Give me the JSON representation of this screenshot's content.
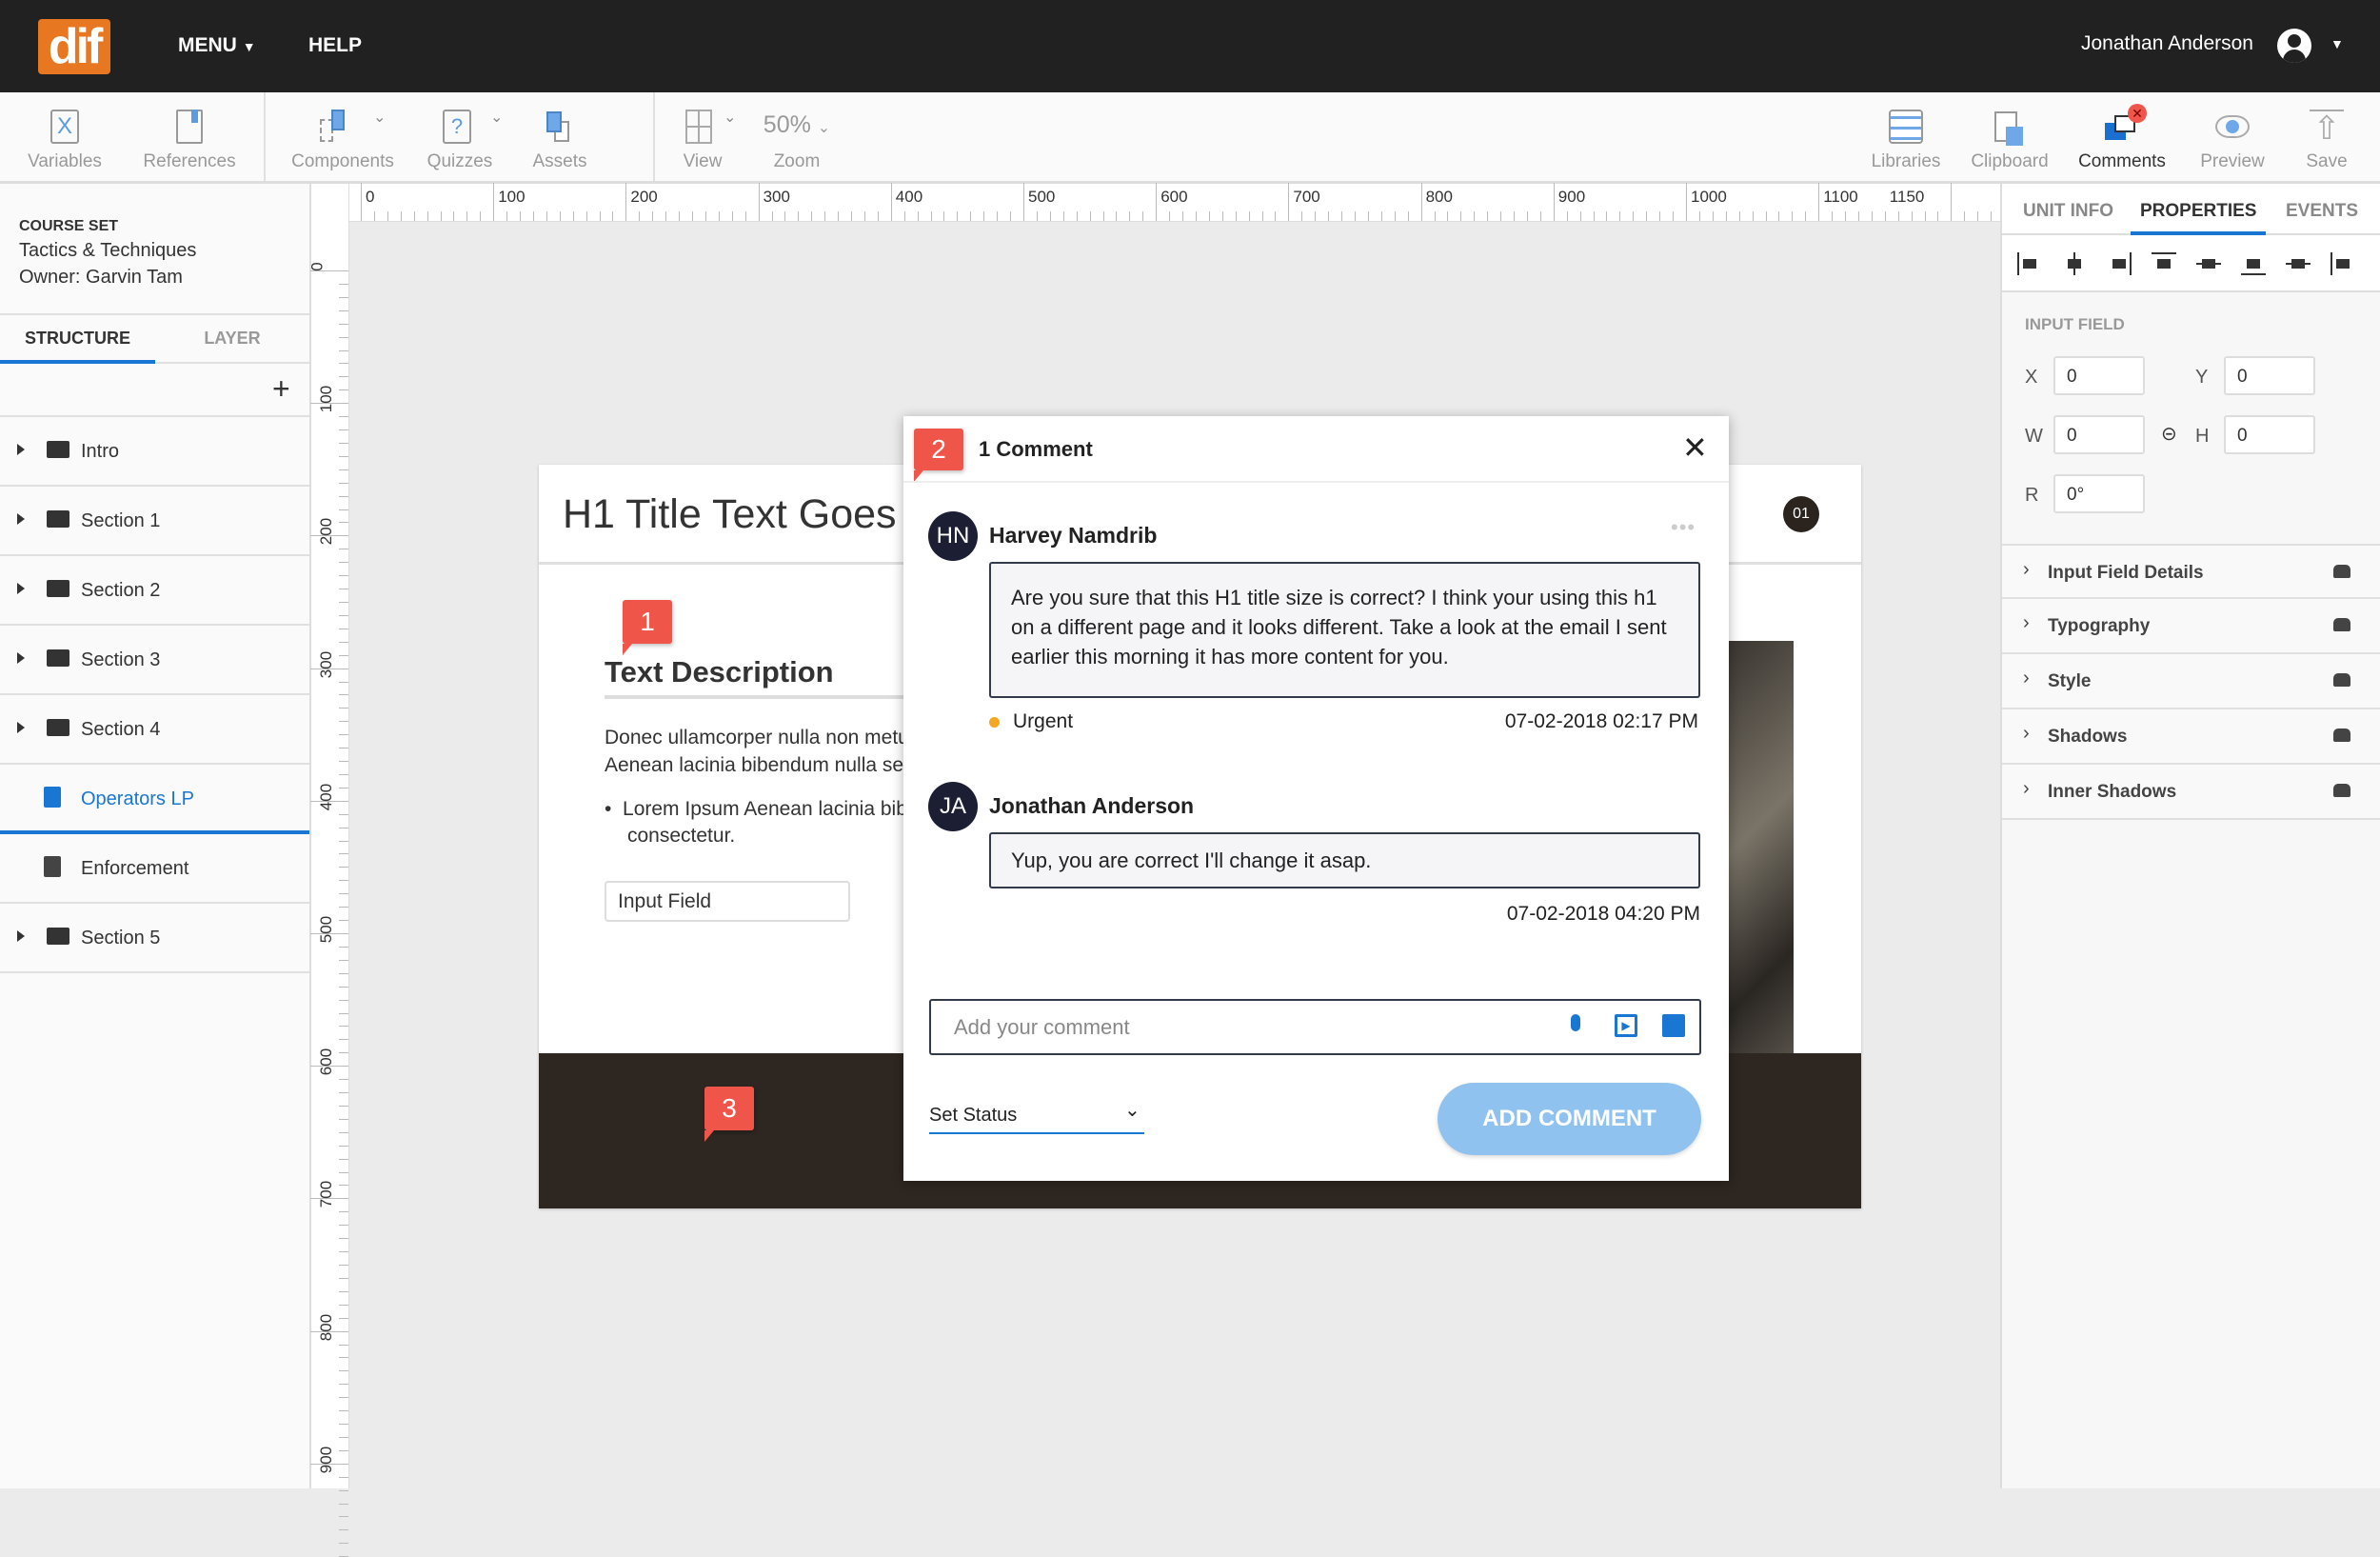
{
  "topbar": {
    "logo": "dif",
    "menu": "MENU",
    "help": "HELP",
    "user": "Jonathan Anderson"
  },
  "toolbar": {
    "left": [
      {
        "label": "Variables",
        "icon": "variable-x-icon"
      },
      {
        "label": "References",
        "icon": "book-icon"
      },
      {
        "label": "Components",
        "icon": "components-icon"
      },
      {
        "label": "Quizzes",
        "icon": "quiz-icon"
      },
      {
        "label": "Assets",
        "icon": "assets-icon"
      },
      {
        "label": "View",
        "icon": "grid-icon"
      },
      {
        "label": "Zoom",
        "value": "50%"
      }
    ],
    "right": [
      {
        "label": "Libraries",
        "icon": "list-icon"
      },
      {
        "label": "Clipboard",
        "icon": "clipboard-icon"
      },
      {
        "label": "Comments",
        "icon": "comments-icon",
        "active": true
      },
      {
        "label": "Preview",
        "icon": "eye-icon"
      },
      {
        "label": "Save",
        "icon": "upload-icon"
      }
    ]
  },
  "left": {
    "course_label": "COURSE SET",
    "course_name": "Tactics & Techniques",
    "owner": "Owner: Garvin Tam",
    "tabs": [
      "STRUCTURE",
      "LAYER"
    ],
    "add": "+",
    "items": [
      {
        "label": "Intro",
        "type": "folder"
      },
      {
        "label": "Section 1",
        "type": "folder"
      },
      {
        "label": "Section 2",
        "type": "folder"
      },
      {
        "label": "Section 3",
        "type": "folder"
      },
      {
        "label": "Section 4",
        "type": "folder"
      },
      {
        "label": "Operators LP",
        "type": "page",
        "selected": true
      },
      {
        "label": "Enforcement",
        "type": "page"
      },
      {
        "label": "Section 5",
        "type": "folder"
      }
    ]
  },
  "rulers": {
    "h": [
      "0",
      "100",
      "200",
      "300",
      "400",
      "500",
      "600",
      "700",
      "800",
      "900",
      "1000",
      "1100",
      "1150"
    ],
    "v": [
      "0",
      "100",
      "200",
      "300",
      "400",
      "500",
      "600",
      "700",
      "800",
      "900"
    ]
  },
  "right": {
    "tabs": [
      "UNIT INFO",
      "PROPERTIES",
      "EVENTS"
    ],
    "active_tab": "PROPERTIES",
    "section": "INPUT FIELD",
    "x": "0",
    "y": "0",
    "w": "0",
    "h": "0",
    "r": "0°",
    "labels": {
      "x": "X",
      "y": "Y",
      "w": "W",
      "h": "H",
      "r": "R"
    },
    "accordion": [
      "Input Field Details",
      "Typography",
      "Style",
      "Shadows",
      "Inner Shadows"
    ]
  },
  "page": {
    "h1": "H1 Title Text Goes Here",
    "badge": "01",
    "pin1": "1",
    "pin3": "3",
    "desc_title": "Text Description",
    "para1": "Donec ullamcorper nulla non metus",
    "para2": "Aenean lacinia bibendum nulla sed",
    "bullet1": "Lorem Ipsum Aenean lacinia bibendum",
    "bullet2": "consectetur.",
    "input": "Input Field"
  },
  "modal": {
    "pin": "2",
    "title": "1 Comment",
    "comments": [
      {
        "initials": "HN",
        "name": "Harvey Namdrib",
        "text": "Are you sure that this H1 title size is correct? I think your using this h1 on a different page and it looks different. Take a look at the email I sent earlier this morning it has more content for you.",
        "status": "Urgent",
        "time": "07-02-2018 02:17 PM"
      },
      {
        "initials": "JA",
        "name": "Jonathan Anderson",
        "text": "Yup, you are correct I'll change it asap.",
        "time": "07-02-2018 04:20 PM"
      }
    ],
    "placeholder": "Add your comment",
    "status_select": "Set Status",
    "submit": "ADD COMMENT"
  },
  "colors": {
    "accent": "#1976d2",
    "pin": "#f0554a",
    "urgent": "#f5a623",
    "button": "#90c2f0",
    "logo": "#e87722"
  }
}
